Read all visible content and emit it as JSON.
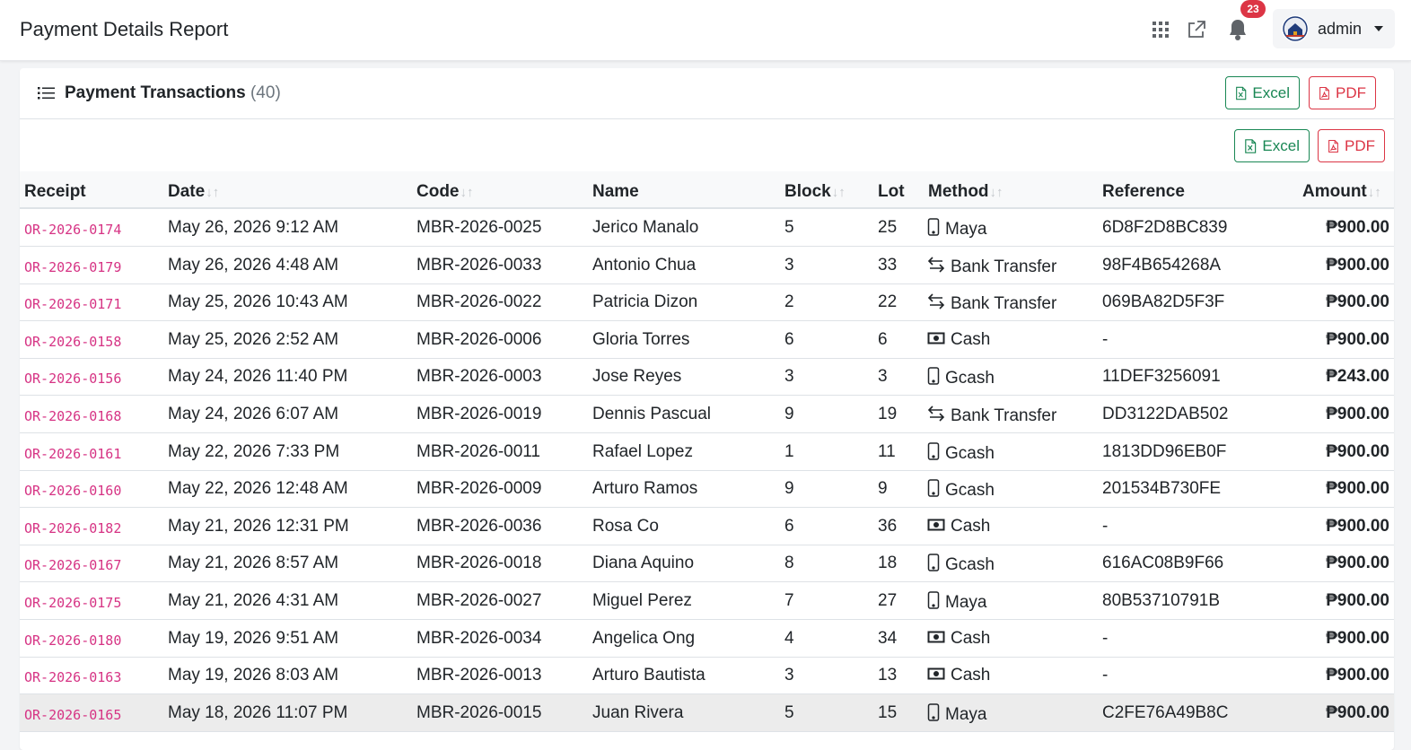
{
  "topbar": {
    "title": "Payment Details Report",
    "notification_count": "23",
    "user_name": "admin",
    "icons": [
      "apps-grid-icon",
      "external-link-icon",
      "bell-icon",
      "avatar-logo-icon",
      "caret-down-icon"
    ]
  },
  "card": {
    "title": "Payment Transactions",
    "count": "(40)",
    "excel_label": "Excel",
    "pdf_label": "PDF"
  },
  "colors": {
    "receipt": "#d63384",
    "excel": "#198754",
    "pdf": "#dc3545",
    "badge": "#dc3545"
  },
  "table": {
    "headers": {
      "receipt": "Receipt",
      "date": "Date",
      "code": "Code",
      "name": "Name",
      "block": "Block",
      "lot": "Lot",
      "method": "Method",
      "reference": "Reference",
      "amount": "Amount"
    },
    "rows": [
      {
        "receipt": "OR-2026-0174",
        "date": "May 26, 2026 9:12 AM",
        "code": "MBR-2026-0025",
        "name": "Jerico Manalo",
        "block": "5",
        "lot": "25",
        "method": "Maya",
        "method_icon": "phone-icon",
        "reference": "6D8F2D8BC839",
        "amount": "₱900.00"
      },
      {
        "receipt": "OR-2026-0179",
        "date": "May 26, 2026 4:48 AM",
        "code": "MBR-2026-0033",
        "name": "Antonio Chua",
        "block": "3",
        "lot": "33",
        "method": "Bank Transfer",
        "method_icon": "transfer-arrows-icon",
        "reference": "98F4B654268A",
        "amount": "₱900.00"
      },
      {
        "receipt": "OR-2026-0171",
        "date": "May 25, 2026 10:43 AM",
        "code": "MBR-2026-0022",
        "name": "Patricia Dizon",
        "block": "2",
        "lot": "22",
        "method": "Bank Transfer",
        "method_icon": "transfer-arrows-icon",
        "reference": "069BA82D5F3F",
        "amount": "₱900.00"
      },
      {
        "receipt": "OR-2026-0158",
        "date": "May 25, 2026 2:52 AM",
        "code": "MBR-2026-0006",
        "name": "Gloria Torres",
        "block": "6",
        "lot": "6",
        "method": "Cash",
        "method_icon": "cash-icon",
        "reference": "-",
        "amount": "₱900.00"
      },
      {
        "receipt": "OR-2026-0156",
        "date": "May 24, 2026 11:40 PM",
        "code": "MBR-2026-0003",
        "name": "Jose Reyes",
        "block": "3",
        "lot": "3",
        "method": "Gcash",
        "method_icon": "phone-icon",
        "reference": "11DEF3256091",
        "amount": "₱243.00"
      },
      {
        "receipt": "OR-2026-0168",
        "date": "May 24, 2026 6:07 AM",
        "code": "MBR-2026-0019",
        "name": "Dennis Pascual",
        "block": "9",
        "lot": "19",
        "method": "Bank Transfer",
        "method_icon": "transfer-arrows-icon",
        "reference": "DD3122DAB502",
        "amount": "₱900.00"
      },
      {
        "receipt": "OR-2026-0161",
        "date": "May 22, 2026 7:33 PM",
        "code": "MBR-2026-0011",
        "name": "Rafael Lopez",
        "block": "1",
        "lot": "11",
        "method": "Gcash",
        "method_icon": "phone-icon",
        "reference": "1813DD96EB0F",
        "amount": "₱900.00"
      },
      {
        "receipt": "OR-2026-0160",
        "date": "May 22, 2026 12:48 AM",
        "code": "MBR-2026-0009",
        "name": "Arturo Ramos",
        "block": "9",
        "lot": "9",
        "method": "Gcash",
        "method_icon": "phone-icon",
        "reference": "201534B730FE",
        "amount": "₱900.00"
      },
      {
        "receipt": "OR-2026-0182",
        "date": "May 21, 2026 12:31 PM",
        "code": "MBR-2026-0036",
        "name": "Rosa Co",
        "block": "6",
        "lot": "36",
        "method": "Cash",
        "method_icon": "cash-icon",
        "reference": "-",
        "amount": "₱900.00"
      },
      {
        "receipt": "OR-2026-0167",
        "date": "May 21, 2026 8:57 AM",
        "code": "MBR-2026-0018",
        "name": "Diana Aquino",
        "block": "8",
        "lot": "18",
        "method": "Gcash",
        "method_icon": "phone-icon",
        "reference": "616AC08B9F66",
        "amount": "₱900.00"
      },
      {
        "receipt": "OR-2026-0175",
        "date": "May 21, 2026 4:31 AM",
        "code": "MBR-2026-0027",
        "name": "Miguel Perez",
        "block": "7",
        "lot": "27",
        "method": "Maya",
        "method_icon": "phone-icon",
        "reference": "80B53710791B",
        "amount": "₱900.00"
      },
      {
        "receipt": "OR-2026-0180",
        "date": "May 19, 2026 9:51 AM",
        "code": "MBR-2026-0034",
        "name": "Angelica Ong",
        "block": "4",
        "lot": "34",
        "method": "Cash",
        "method_icon": "cash-icon",
        "reference": "-",
        "amount": "₱900.00"
      },
      {
        "receipt": "OR-2026-0163",
        "date": "May 19, 2026 8:03 AM",
        "code": "MBR-2026-0013",
        "name": "Arturo Bautista",
        "block": "3",
        "lot": "13",
        "method": "Cash",
        "method_icon": "cash-icon",
        "reference": "-",
        "amount": "₱900.00"
      },
      {
        "receipt": "OR-2026-0165",
        "date": "May 18, 2026 11:07 PM",
        "code": "MBR-2026-0015",
        "name": "Juan Rivera",
        "block": "5",
        "lot": "15",
        "method": "Maya",
        "method_icon": "phone-icon",
        "reference": "C2FE76A49B8C",
        "amount": "₱900.00"
      }
    ]
  }
}
